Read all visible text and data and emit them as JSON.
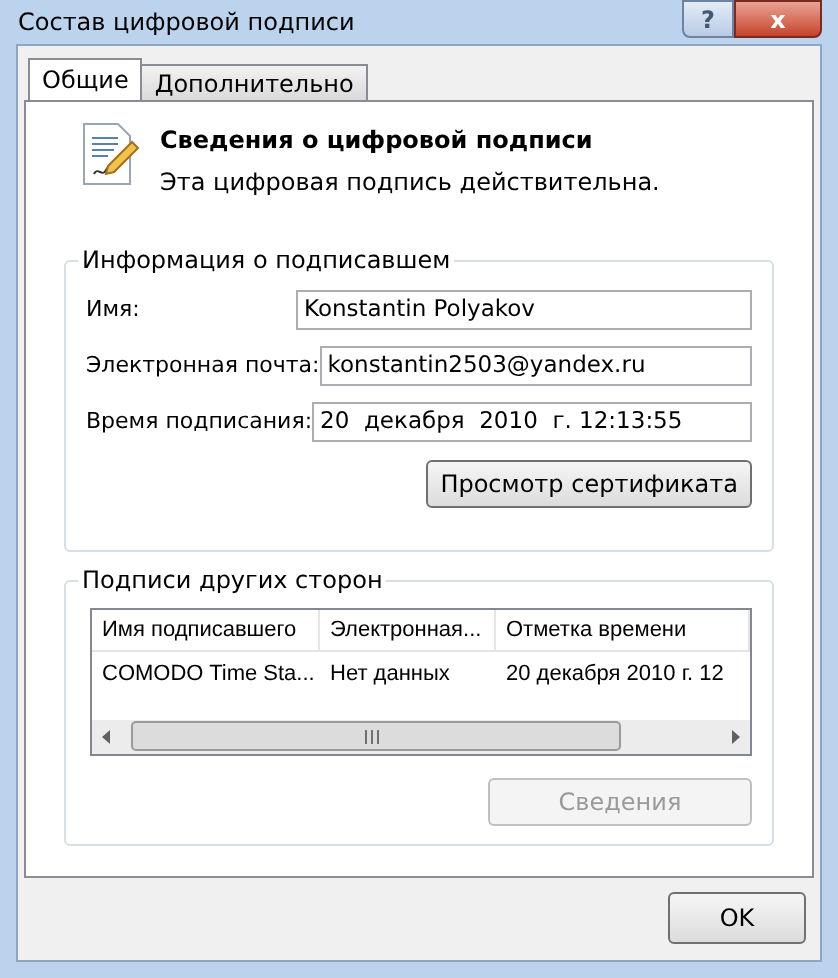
{
  "window": {
    "title": "Состав цифровой подписи",
    "help": "?",
    "close": "x"
  },
  "tabs": [
    {
      "label": "Общие",
      "selected": true
    },
    {
      "label": "Дополнительно",
      "selected": false
    }
  ],
  "header": {
    "title": "Сведения о цифровой подписи",
    "subtitle": "Эта цифровая подпись действительна."
  },
  "signer_info": {
    "title": "Информация о подписавшем",
    "fields": [
      {
        "label": "Имя:",
        "value": "Konstantin Polyakov"
      },
      {
        "label": "Электронная почта:",
        "value": "konstantin2503@yandex.ru"
      },
      {
        "label": "Время подписания:",
        "value": "20  декабря  2010  г. 12:13:55"
      }
    ],
    "button": {
      "label": "Просмотр сертификата",
      "disabled": false
    }
  },
  "countersignatures": {
    "title": "Подписи других сторон",
    "table": {
      "columns": [
        "Имя подписавшего",
        "Электронная...",
        "Отметка времени"
      ],
      "rows": [
        [
          "COMODO Time Sta...",
          "Нет данных",
          "20 декабря 2010 г. 12"
        ]
      ]
    },
    "button": {
      "label": "Сведения",
      "disabled": true
    }
  },
  "buttons": [
    {
      "label": "OK",
      "disabled": false
    }
  ]
}
